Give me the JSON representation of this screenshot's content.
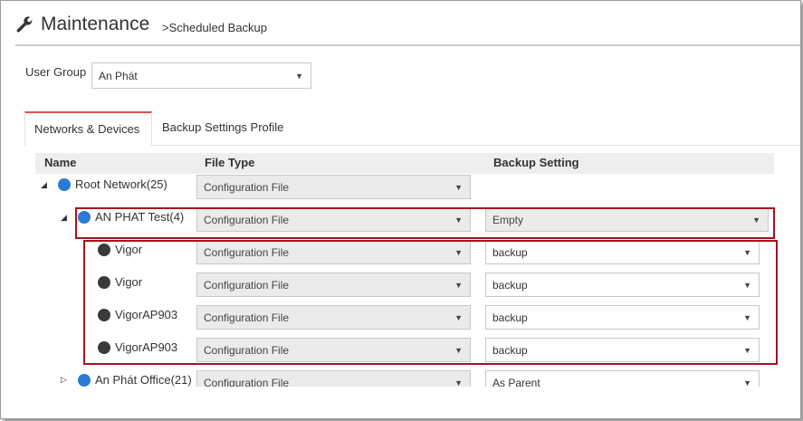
{
  "header": {
    "title": "Maintenance",
    "subtitle": ">Scheduled Backup"
  },
  "user_group": {
    "label": "User Group",
    "value": "An Phát"
  },
  "tabs": [
    {
      "label": "Networks & Devices"
    },
    {
      "label": "Backup Settings Profile"
    }
  ],
  "table": {
    "columns": {
      "name": "Name",
      "file_type": "File Type",
      "backup_setting": "Backup Setting"
    },
    "rows": [
      {
        "name": "Root Network(25)",
        "file_type": "Configuration File",
        "backup_setting": ""
      },
      {
        "name": "AN PHAT Test(4)",
        "file_type": "Configuration File",
        "backup_setting": "Empty"
      },
      {
        "name": "Vigor",
        "file_type": "Configuration File",
        "backup_setting": "backup"
      },
      {
        "name": "Vigor",
        "file_type": "Configuration File",
        "backup_setting": "backup"
      },
      {
        "name": "VigorAP903",
        "file_type": "Configuration File",
        "backup_setting": "backup"
      },
      {
        "name": "VigorAP903",
        "file_type": "Configuration File",
        "backup_setting": "backup"
      },
      {
        "name": "An Phát Office(21)",
        "file_type": "Configuration File",
        "backup_setting": "As Parent"
      }
    ]
  },
  "icons": {
    "wrench": "wrench-icon",
    "network": "network-icon",
    "device": "device-icon"
  }
}
